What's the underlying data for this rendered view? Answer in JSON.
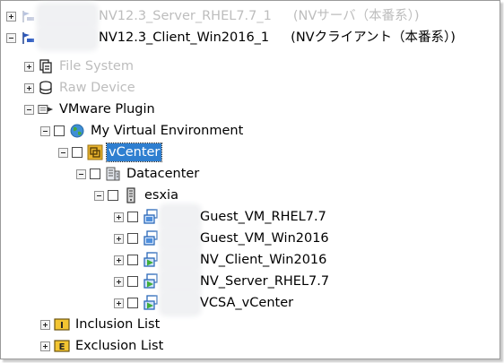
{
  "tree": {
    "server_node": {
      "name": "NV12.3_Server_RHEL7.7_1",
      "role": "(NVサーバ（本番系）)"
    },
    "client_node": {
      "name": "NV12.3_Client_Win2016_1",
      "role": "(NVクライアント（本番系）)"
    },
    "file_system": "File System",
    "raw_device": "Raw Device",
    "vmware_plugin": "VMware Plugin",
    "virtual_env": "My Virtual Environment",
    "vcenter": "vCenter",
    "datacenter": "Datacenter",
    "host": "esxia",
    "vms": [
      {
        "name": "Guest_VM_RHEL7.7",
        "icon": "vm-blue-icon"
      },
      {
        "name": "Guest_VM_Win2016",
        "icon": "vm-blue-icon"
      },
      {
        "name": "NV_Client_Win2016",
        "icon": "vm-green-icon"
      },
      {
        "name": "NV_Server_RHEL7.7",
        "icon": "vm-green-icon"
      },
      {
        "name": "VCSA_vCenter",
        "icon": "vm-green-icon"
      }
    ],
    "inclusion_list": "Inclusion List",
    "exclusion_list": "Exclusion List"
  },
  "colors": {
    "selection": "#2f7fd0",
    "disabled_text": "#bdbdbd"
  }
}
